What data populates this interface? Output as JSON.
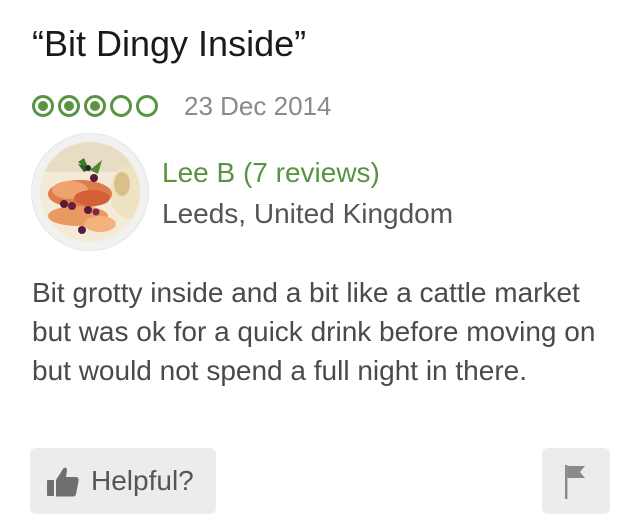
{
  "review": {
    "title": "“Bit Dingy Inside”",
    "rating": {
      "value": 3,
      "max": 5,
      "color": "#589442"
    },
    "date": "23 Dec 2014",
    "reviewer": {
      "name": "Lee B (7 reviews)",
      "location": "Leeds, United Kingdom",
      "avatar_icon": "food-photo-avatar"
    },
    "text": "Bit grotty inside and a bit like a cattle market but was ok for a quick drink before moving on but would not spend a full night in there.",
    "actions": {
      "helpful_label": "Helpful?",
      "helpful_icon": "thumbs-up-icon",
      "flag_icon": "flag-icon"
    }
  }
}
